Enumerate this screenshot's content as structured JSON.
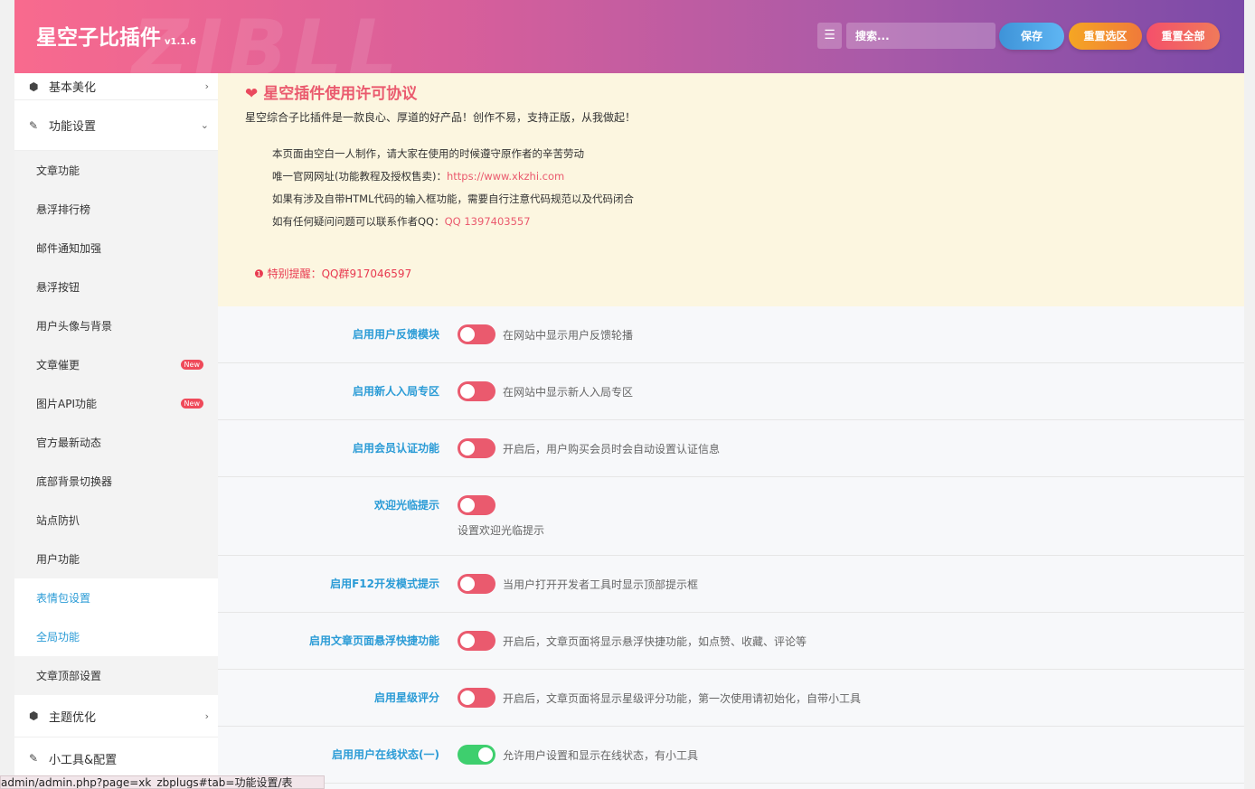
{
  "header": {
    "watermark": "ZIBLL",
    "brand": "星空子比插件",
    "version": "v1.1.6",
    "menu_icon": "☰",
    "search_placeholder": "搜索...",
    "save": "保存",
    "reset_section": "重置选区",
    "reset_all": "重置全部"
  },
  "sidebar": {
    "basic": {
      "icon": "cube-icon",
      "label": "基本美化",
      "chev": "›"
    },
    "func": {
      "icon": "brush-icon",
      "label": "功能设置",
      "chev": "⌄"
    },
    "items": [
      {
        "label": "文章功能"
      },
      {
        "label": "悬浮排行榜"
      },
      {
        "label": "邮件通知加强"
      },
      {
        "label": "悬浮按钮"
      },
      {
        "label": "用户头像与背景"
      },
      {
        "label": "文章催更",
        "badge": "New"
      },
      {
        "label": "图片API功能",
        "badge": "New"
      },
      {
        "label": "官方最新动态"
      },
      {
        "label": "底部背景切换器"
      },
      {
        "label": "站点防扒"
      },
      {
        "label": "用户功能"
      },
      {
        "label": "表情包设置"
      },
      {
        "label": "全局功能"
      },
      {
        "label": "文章顶部设置"
      }
    ],
    "theme": {
      "icon": "cube-icon",
      "label": "主题优化",
      "chev": "›"
    },
    "tools": {
      "icon": "brush-icon",
      "label": "小工具&配置"
    }
  },
  "notice": {
    "title": "星空插件使用许可协议",
    "subtitle": "星空综合子比插件是一款良心、厚道的好产品！创作不易，支持正版，从我做起！",
    "line1": "本页面由空白一人制作，请大家在使用的时候遵守原作者的辛苦劳动",
    "line2_prefix": "唯一官网网址(功能教程及授权售卖)：",
    "line2_link": "https://www.xkzhi.com",
    "line3": "如果有涉及自带HTML代码的输入框功能，需要自行注意代码规范以及代码闭合",
    "line4_prefix": "如有任何疑问问题可以联系作者QQ：",
    "line4_link": "QQ 1397403557",
    "warn_icon": "❶",
    "warn": "特别提醒：QQ群917046597"
  },
  "settings": [
    {
      "label": "启用用户反馈模块",
      "desc": "在网站中显示用户反馈轮播",
      "on": false
    },
    {
      "label": "启用新人入局专区",
      "desc": "在网站中显示新人入局专区",
      "on": false
    },
    {
      "label": "启用会员认证功能",
      "desc": "开启后，用户购买会员时会自动设置认证信息",
      "on": false
    },
    {
      "label": "欢迎光临提示",
      "desc": "设置欢迎光临提示",
      "on": false
    },
    {
      "label": "启用F12开发模式提示",
      "desc": "当用户打开开发者工具时显示顶部提示框",
      "on": false
    },
    {
      "label": "启用文章页面悬浮快捷功能",
      "desc": "开启后，文章页面将显示悬浮快捷功能，如点赞、收藏、评论等",
      "on": false
    },
    {
      "label": "启用星级评分",
      "desc": "开启后，文章页面将显示星级评分功能，第一次使用请初始化，自带小工具",
      "on": false
    },
    {
      "label": "启用用户在线状态(一)",
      "desc": "允许用户设置和显示在线状态，有小工具",
      "on": true
    }
  ],
  "statusbar": "admin/admin.php?page=xk_zbplugs#tab=功能设置/表"
}
